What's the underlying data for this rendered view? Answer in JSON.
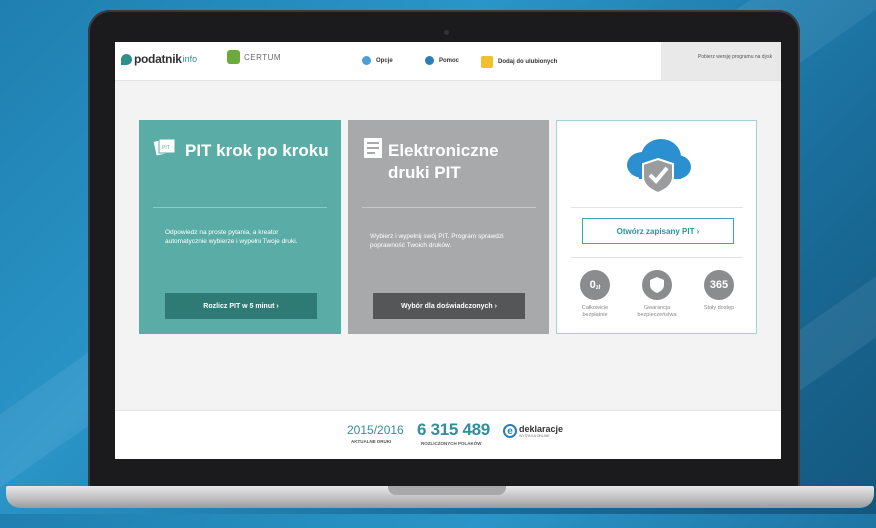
{
  "header": {
    "logo_text": "podatnik",
    "logo_suffix": "info",
    "certum_text": "CERTUM",
    "nav": [
      {
        "label": "Opcje",
        "icon": "gears-icon"
      },
      {
        "label": "Pomoc",
        "icon": "question-icon"
      },
      {
        "label": "Dodaj do ulubionych",
        "icon": "star-icon"
      }
    ],
    "download_label": "Pobierz wersję programu na dysk"
  },
  "tiles": {
    "krok": {
      "title": "PIT krok po kroku",
      "description": "Odpowiedz na proste pytania, a kreator automatycznie wybierze i wypełni Twoje druki.",
      "button": "Rozlicz PIT w 5 minut ›"
    },
    "druki": {
      "title": "Elektroniczne druki PIT",
      "description": "Wybierz i wypełnij swój PIT. Program sprawdzi poprawność Twoich druków.",
      "button": "Wybór dla doświadczonych ›"
    },
    "open": {
      "button": "Otwórz zapisany PIT ›",
      "features": [
        {
          "value": "0",
          "unit": "zł",
          "label": "Całkowicie bezpłatnie"
        },
        {
          "value": "",
          "label": "Gwarancja bezpieczeństwa"
        },
        {
          "value": "365",
          "label": "Stały dostęp"
        }
      ]
    }
  },
  "footer": {
    "year": "2015/2016",
    "year_label": "AKTUALNE DRUKI",
    "count": "6 315 489",
    "count_label": "ROZLICZONYCH POLAKÓW",
    "edeklaracje": "deklaracje",
    "edeklaracje_sub": "WYSYŁKA ONLINE"
  },
  "colors": {
    "teal": "#5aada6",
    "gray": "#a7a9ab",
    "accent": "#3aa8b2"
  }
}
